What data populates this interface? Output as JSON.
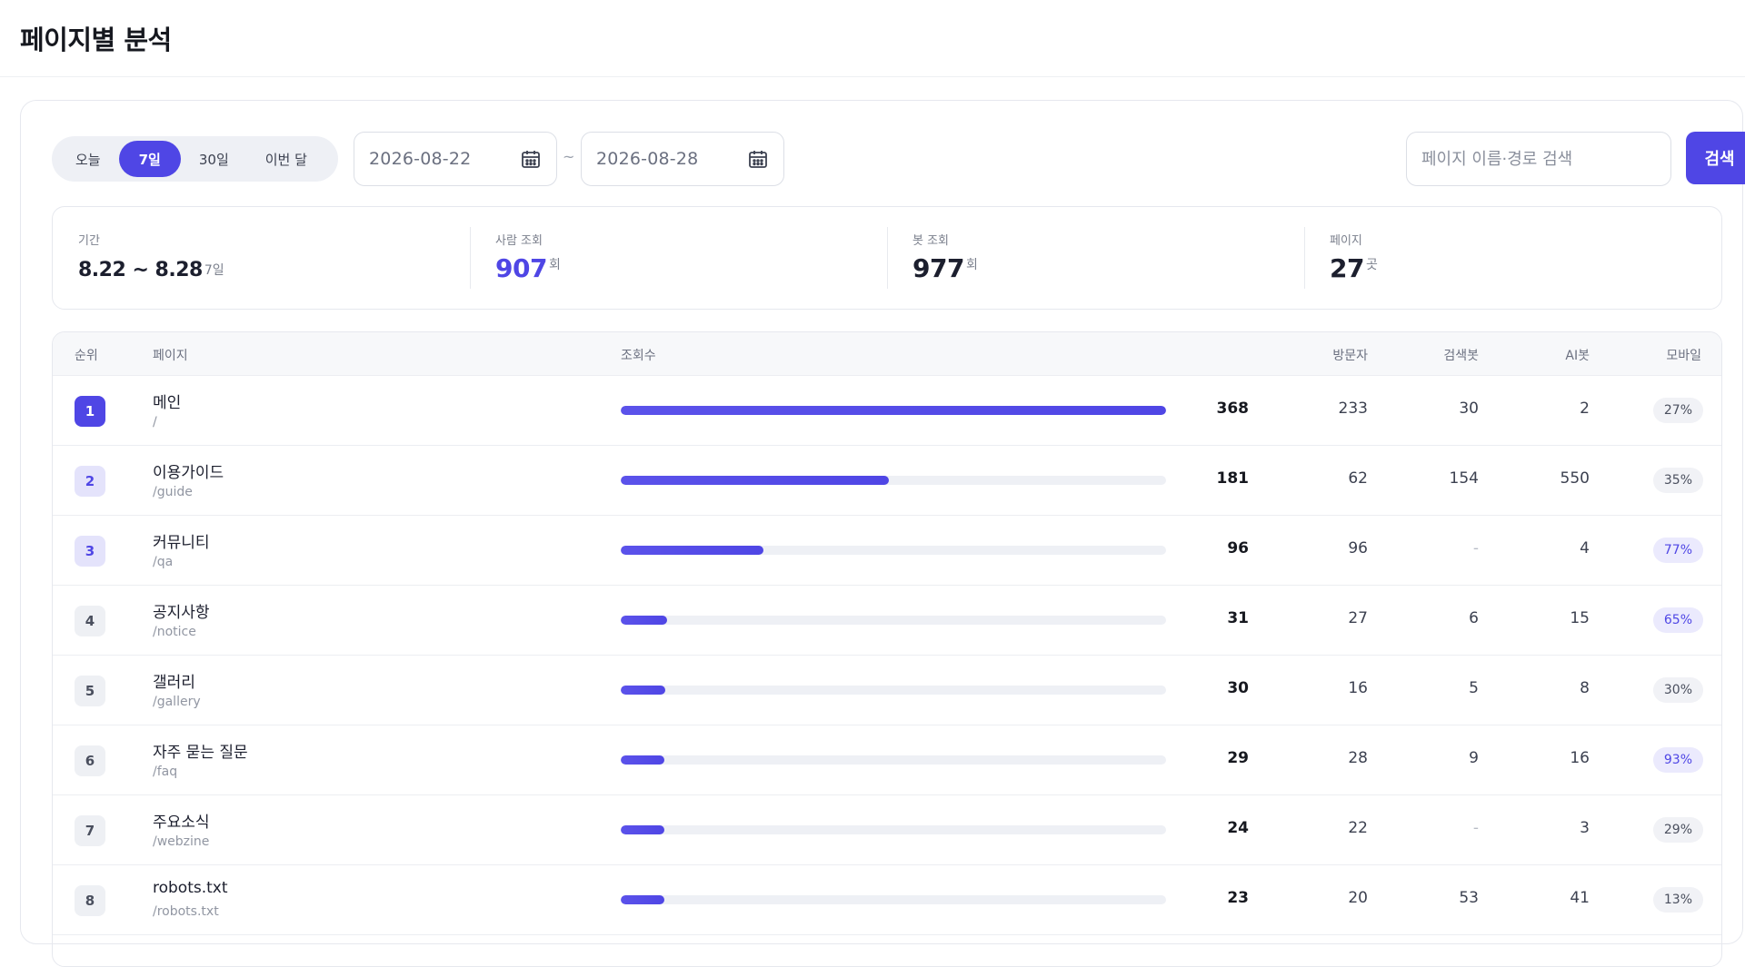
{
  "header": {
    "title": "페이지별 분석"
  },
  "toolbar": {
    "periods": [
      {
        "label": "오늘",
        "active": false
      },
      {
        "label": "7일",
        "active": true
      },
      {
        "label": "30일",
        "active": false
      },
      {
        "label": "이번 달",
        "active": false
      }
    ],
    "date_from": "2026-08-22",
    "date_to": "2026-08-28",
    "tilde": "~",
    "search_placeholder": "페이지 이름·경로 검색",
    "search_label": "검색"
  },
  "stats": {
    "period": {
      "label": "기간",
      "value": "8.22 ~ 8.28",
      "unit": "7일"
    },
    "human_views": {
      "label": "사람 조회",
      "value": "907",
      "unit": "회"
    },
    "bot_views": {
      "label": "봇 조회",
      "value": "977",
      "unit": "회"
    },
    "pages": {
      "label": "페이지",
      "value": "27",
      "unit": "곳"
    }
  },
  "table": {
    "columns": {
      "rank": "순위",
      "page": "페이지",
      "views": "조회수",
      "visitors": "방문자",
      "search_bot": "검색봇",
      "ai_bot": "AI봇",
      "mobile": "모바일"
    },
    "rows": [
      {
        "rank": "1",
        "name": "메인",
        "path": "/",
        "views": 368,
        "visitors": "233",
        "search_bot": "30",
        "ai_bot": "2",
        "mobile": "27%",
        "mobile_hi": false
      },
      {
        "rank": "2",
        "name": "이용가이드",
        "path": "/guide",
        "views": 181,
        "visitors": "62",
        "search_bot": "154",
        "ai_bot": "550",
        "mobile": "35%",
        "mobile_hi": false
      },
      {
        "rank": "3",
        "name": "커뮤니티",
        "path": "/qa",
        "views": 96,
        "visitors": "96",
        "search_bot": "-",
        "ai_bot": "4",
        "mobile": "77%",
        "mobile_hi": true
      },
      {
        "rank": "4",
        "name": "공지사항",
        "path": "/notice",
        "views": 31,
        "visitors": "27",
        "search_bot": "6",
        "ai_bot": "15",
        "mobile": "65%",
        "mobile_hi": true
      },
      {
        "rank": "5",
        "name": "갤러리",
        "path": "/gallery",
        "views": 30,
        "visitors": "16",
        "search_bot": "5",
        "ai_bot": "8",
        "mobile": "30%",
        "mobile_hi": false
      },
      {
        "rank": "6",
        "name": "자주 묻는 질문",
        "path": "/faq",
        "views": 29,
        "visitors": "28",
        "search_bot": "9",
        "ai_bot": "16",
        "mobile": "93%",
        "mobile_hi": true
      },
      {
        "rank": "7",
        "name": "주요소식",
        "path": "/webzine",
        "views": 24,
        "visitors": "22",
        "search_bot": "-",
        "ai_bot": "3",
        "mobile": "29%",
        "mobile_hi": false
      },
      {
        "rank": "8",
        "name": "robots.txt",
        "path": "/robots.txt",
        "views": 23,
        "visitors": "20",
        "search_bot": "53",
        "ai_bot": "41",
        "mobile": "13%",
        "mobile_hi": false
      }
    ]
  },
  "colors": {
    "accent": "#4f46e5",
    "accent_light": "#e4e3fb"
  }
}
